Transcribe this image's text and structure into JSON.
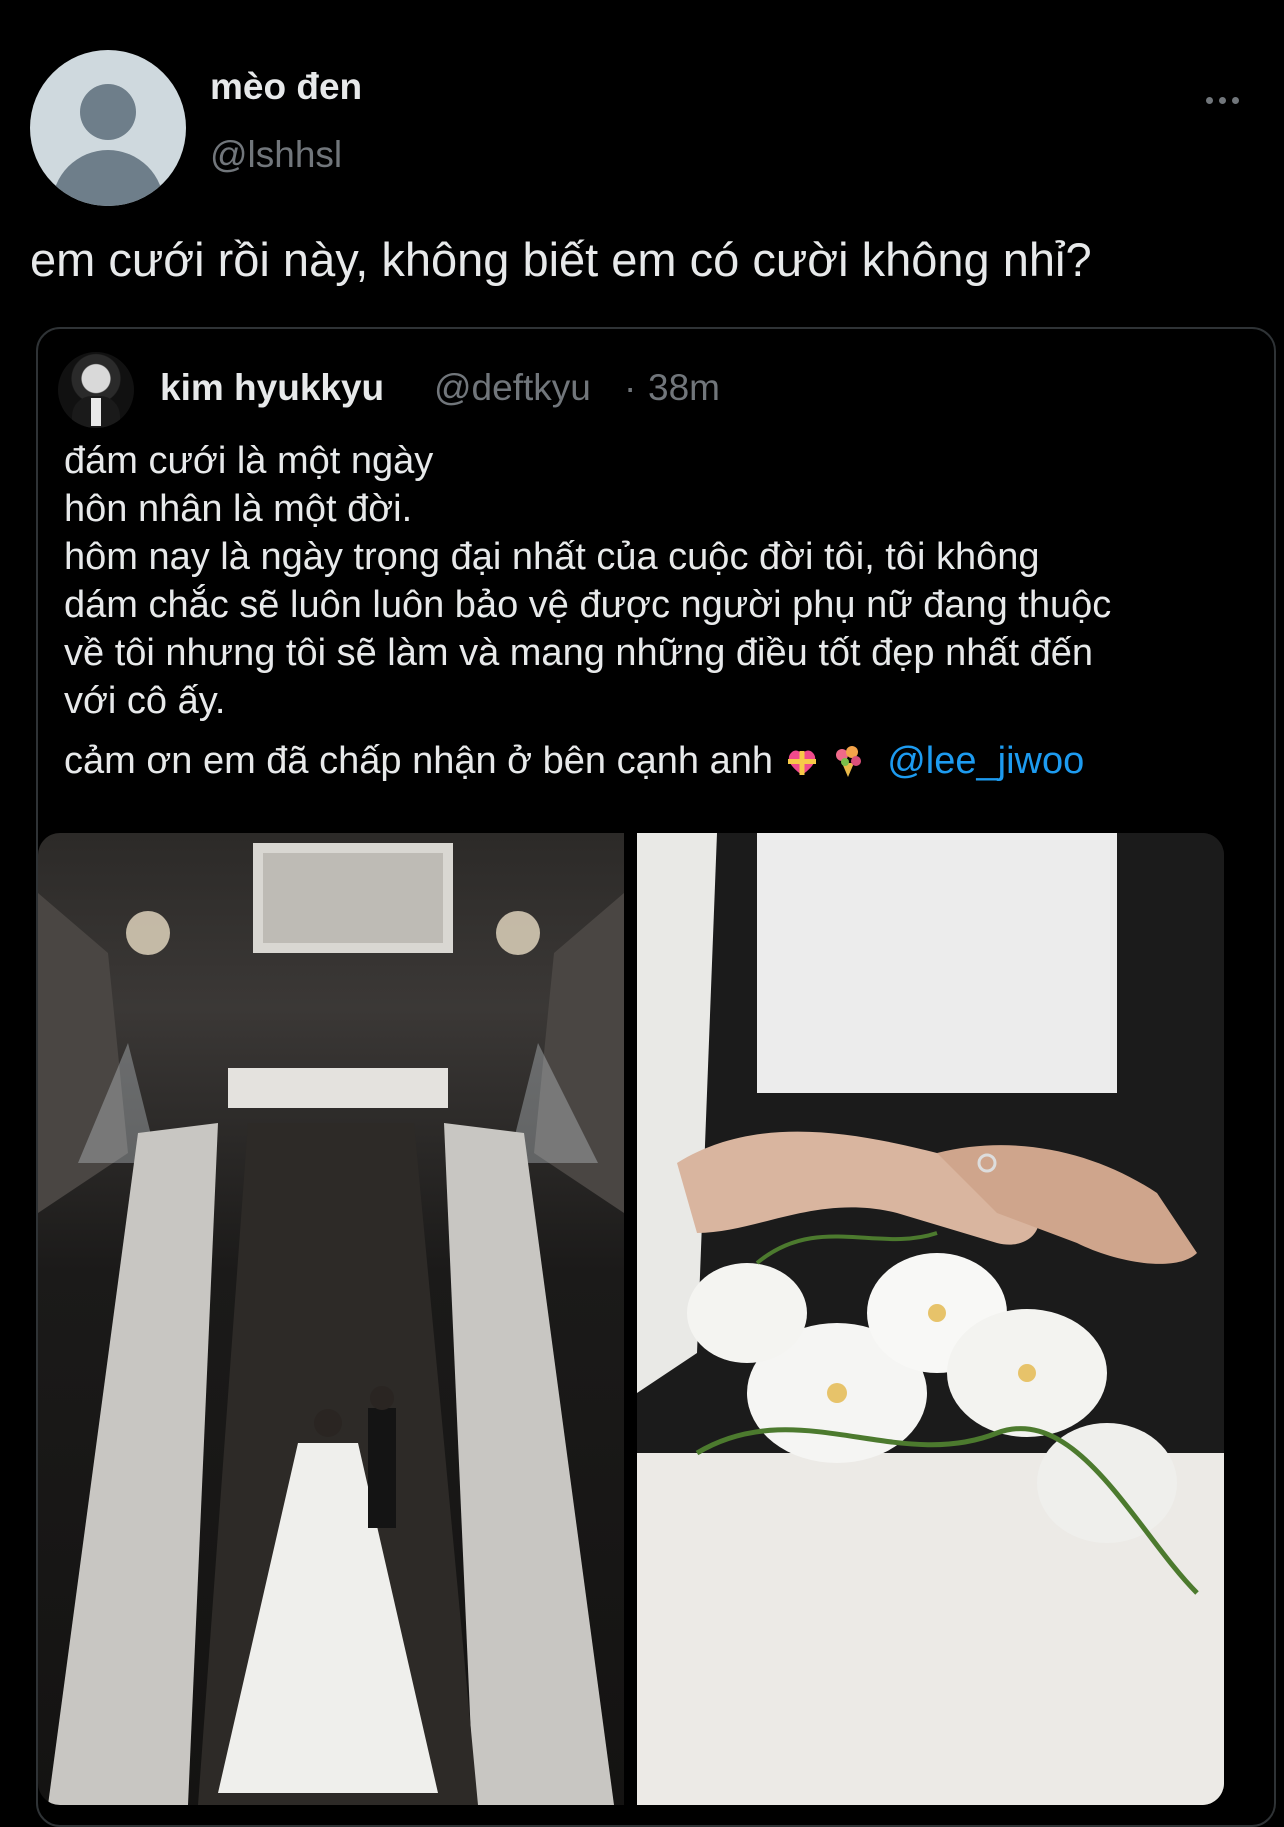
{
  "tweet": {
    "display_name": "mèo đen",
    "handle": "@lshhsl",
    "text": "em cưới rồi này, không biết em có cười không nhỉ?",
    "more_icon": "more-horizontal-icon"
  },
  "quoted_tweet": {
    "display_name": "kim hyukkyu",
    "handle": "@deftkyu",
    "separator": "·",
    "time": "38m",
    "lines": [
      "đám cưới là một ngày",
      "hôn nhân là một đời.",
      "hôm nay là ngày trọng đại nhất của cuộc đời tôi, tôi không",
      "dám chắc sẽ luôn luôn bảo vệ được người phụ nữ đang thuộc",
      "về tôi nhưng tôi sẽ làm và mang những điều tốt đẹp nhất đến",
      "với cô ấy."
    ],
    "closing_text": "cảm ơn em đã chấp nhận ở bên cạnh anh",
    "mention": "@lee_jiwoo",
    "emojis": [
      "heart-with-ribbon-icon",
      "bouquet-icon"
    ]
  },
  "colors": {
    "background": "#000000",
    "text": "#e7e9ea",
    "secondary": "#71767b",
    "border": "#2f3336",
    "link": "#1d9bf0"
  }
}
